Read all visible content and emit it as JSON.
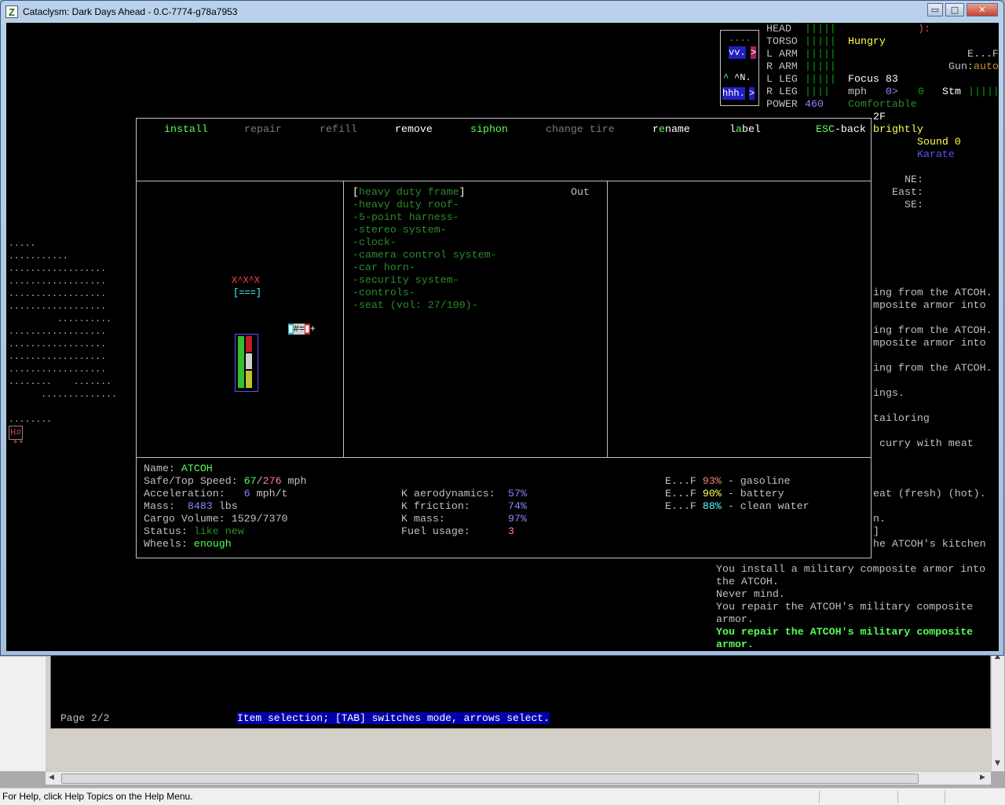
{
  "window": {
    "title": "Cataclysm: Dark Days Ahead - 0.C-7774-g78a7953",
    "icon_letter": "Z",
    "buttons": {
      "minimize": "▭",
      "maximize": "□",
      "close": "✕"
    }
  },
  "sidebar": {
    "body_parts": [
      {
        "label": "HEAD",
        "health": "|||||"
      },
      {
        "label": "TORSO",
        "health": "|||||"
      },
      {
        "label": "L ARM",
        "health": "|||||"
      },
      {
        "label": "R ARM",
        "health": "|||||"
      },
      {
        "label": "L LEG",
        "health": "|||||"
      },
      {
        "label": "R LEG",
        "health": "||||"
      }
    ],
    "power_label": "POWER",
    "power_value": "460",
    "mood_face": "):",
    "hunger": "Hungry",
    "weapon_line": "E...F",
    "gun_label": "Gun:",
    "gun_mode": "auto",
    "focus": "Focus 83",
    "speed_label": "mph",
    "speed_value": "0>",
    "speed_value2": "0",
    "stamina_label": "Stm",
    "stamina_bars": "|||||",
    "temperature": "Comfortable",
    "floor": "2F",
    "light": "brightly",
    "sound": "Sound 0",
    "style": "Karate",
    "directions": [
      "NE:",
      "East:",
      "SE:"
    ],
    "minimap": {
      "row1": "....",
      "row2a": "vv.",
      "row2b": ">",
      "row3a": "^",
      "row3b": "^N.",
      "row4a": "hhh.",
      "row4b": ">"
    }
  },
  "messages": {
    "partial_lines": [
      "ing from the ATCOH.",
      "mposite armor into",
      "ing from the ATCOH.",
      "mposite armor into",
      "ing from the ATCOH.",
      "ings.",
      "tailoring",
      " curry with meat",
      "eat (fresh) (hot).",
      "n.",
      "]",
      "he ATCOH's kitchen"
    ],
    "log": [
      "You install a military composite armor into",
      "the ATCOH.",
      "Never mind.",
      "You repair the ATCOH's military composite",
      "armor."
    ],
    "latest": [
      "You repair the ATCOH's military composite",
      "armor."
    ]
  },
  "vehicle_menu": {
    "actions": [
      {
        "key": "i",
        "rest": "nstall",
        "enabled": true
      },
      {
        "key": "r",
        "rest": "epair",
        "enabled": false
      },
      {
        "key": "r",
        "rest": "efill",
        "enabled": false,
        "prefix": "",
        "label": "refill"
      },
      {
        "key": "",
        "rest": "remove",
        "enabled": true
      },
      {
        "key": "s",
        "rest": "iphon",
        "enabled": true
      },
      {
        "key": "",
        "rest": "change tire",
        "enabled": false
      },
      {
        "key": "",
        "rest": "name",
        "enabled": true
      },
      {
        "key": "",
        "rest": "label",
        "enabled": true
      },
      {
        "key": "ESC",
        "rest": "-back",
        "enabled": true
      }
    ],
    "labels": {
      "install": "install",
      "repair": "repair",
      "refill": "refill",
      "remove": "remove",
      "siphon": "siphon",
      "change_tire": "change tire",
      "rename_pre": "r",
      "rename_key": "e",
      "rename_post": "name",
      "label_pre": "l",
      "label_key": "a",
      "label_post": "bel",
      "esc_key": "ESC",
      "esc_rest": "-back"
    },
    "parts_header_status": "Out",
    "parts": [
      "[heavy duty frame]",
      "-heavy duty roof-",
      "-5-point harness-",
      "-stereo system-",
      "-clock-",
      "-camera control system-",
      "-car horn-",
      "-security system-",
      "-controls-",
      "-seat (vol: 27/100)-"
    ],
    "vehicle_picture": {
      "row1": "X^X^X",
      "row2": "[===]",
      "row3": "▮#=",
      "row4": "[&=&]"
    },
    "info": {
      "name_label": "Name: ",
      "name_value": "ATCOH",
      "speed_label": "Safe/Top Speed: ",
      "safe_speed": "67",
      "top_speed": "276",
      "speed_unit": " mph",
      "accel_label": "Acceleration:   ",
      "accel_value": "6",
      "accel_unit": " mph/t",
      "mass_label": "Mass:  ",
      "mass_value": "8483",
      "mass_unit": " lbs",
      "cargo_label": "Cargo Volume: ",
      "cargo_value": "1529/7370",
      "status_label": "Status: ",
      "status_value": "like new",
      "wheels_label": "Wheels: ",
      "wheels_value": "enough",
      "k_aero_label": "K aerodynamics:",
      "k_aero_value": "57%",
      "k_friction_label": "K friction:",
      "k_friction_value": "74%",
      "k_mass_label": "K mass:",
      "k_mass_value": "97%",
      "fuel_usage_label": "Fuel usage:",
      "fuel_usage_value": "3"
    },
    "fuels": [
      {
        "gauge_e": "E...F",
        "percent": "93%",
        "name": " - gasoline"
      },
      {
        "gauge_e": "E...F",
        "percent": "90%",
        "name": " - battery"
      },
      {
        "gauge_e": "E...F",
        "percent": "88%",
        "name": " - clean water"
      }
    ]
  },
  "bottom_terminal": {
    "page": "Page 2/2",
    "hint": "Item selection; [TAB] switches mode, arrows select."
  },
  "statusbar": {
    "text": "For Help, click Help Topics on the Help Menu."
  },
  "map": {
    "rows": [
      ".....",
      "...........",
      "..................",
      "..................",
      "..................",
      "..................",
      "         ..........",
      "..................",
      "..................",
      "..................",
      "..................",
      "........    .......",
      "      ..............",
      "........"
    ],
    "door": "H#",
    "marker": "**"
  }
}
